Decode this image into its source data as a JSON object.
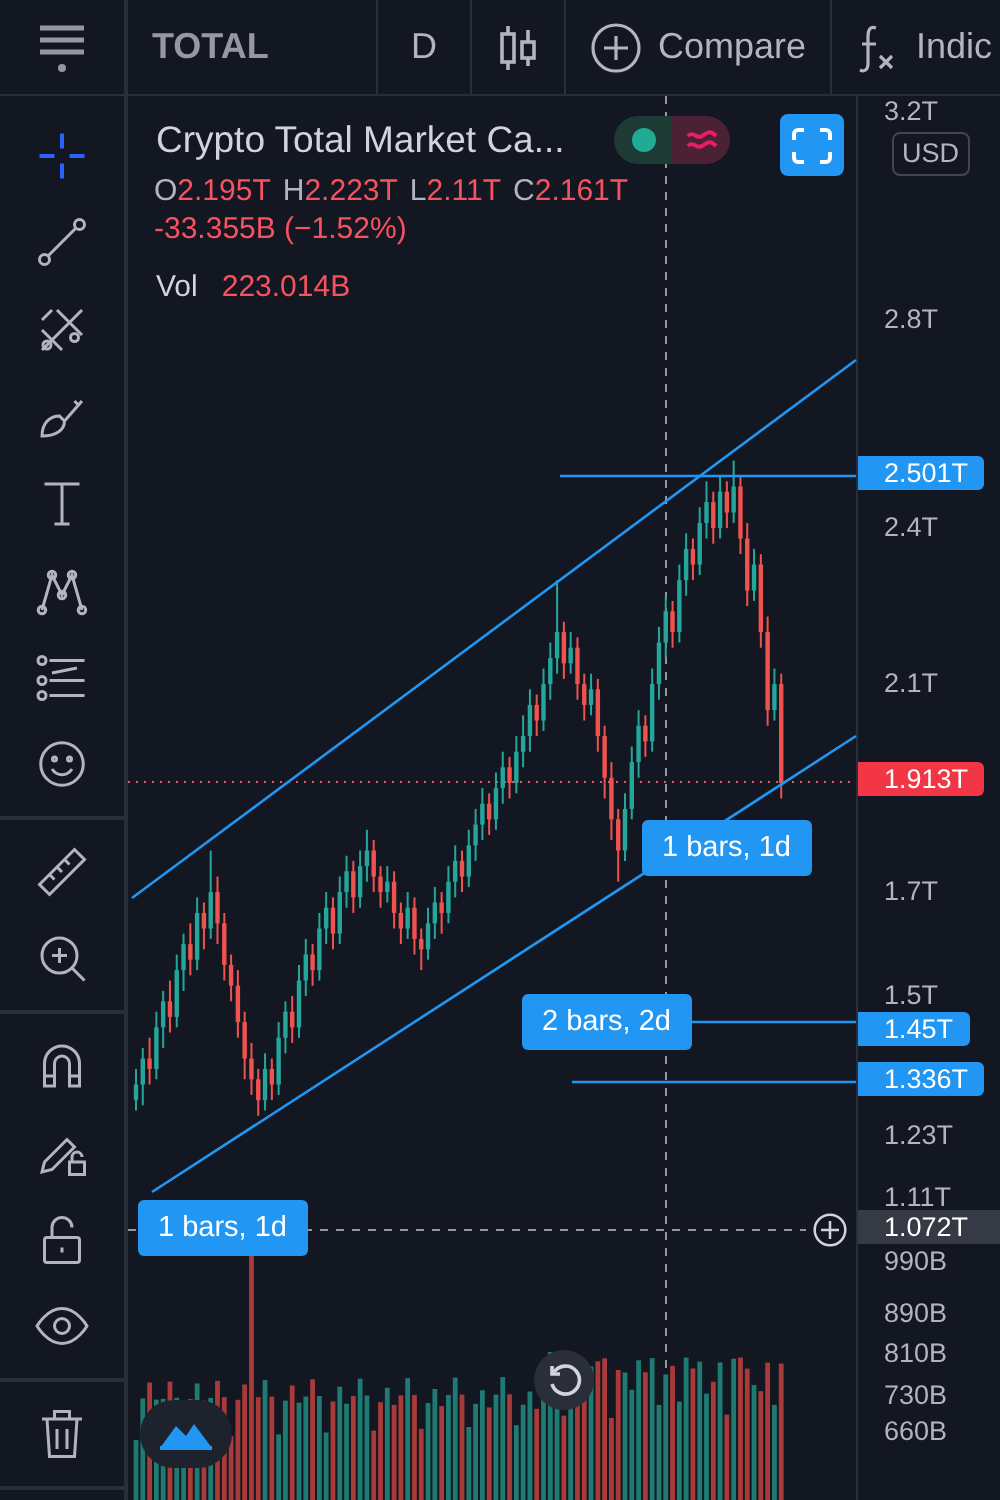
{
  "top_bar": {
    "symbol": "TOTAL",
    "interval": "D",
    "compare": "Compare",
    "indicators": "Indic"
  },
  "tool_groups": [
    [
      {
        "kind": "crosshair",
        "selected": true
      },
      {
        "kind": "line",
        "selected": false
      },
      {
        "kind": "pitchfork",
        "selected": false
      },
      {
        "kind": "brush",
        "selected": false
      },
      {
        "kind": "text",
        "selected": false
      },
      {
        "kind": "pattern",
        "selected": false
      },
      {
        "kind": "forecast",
        "selected": false
      },
      {
        "kind": "emoji",
        "selected": false
      }
    ],
    [
      {
        "kind": "ruler",
        "selected": false
      },
      {
        "kind": "zoom",
        "selected": false
      }
    ],
    [
      {
        "kind": "magnet",
        "selected": false
      },
      {
        "kind": "pencil-lock",
        "selected": false
      },
      {
        "kind": "lock",
        "selected": false
      },
      {
        "kind": "eye",
        "selected": false
      }
    ],
    [
      {
        "kind": "trash",
        "selected": false
      }
    ]
  ],
  "legend": {
    "title": "Crypto Total Market Ca...",
    "ohlc": [
      {
        "label": "O",
        "value": "2.195T"
      },
      {
        "label": "H",
        "value": "2.223T"
      },
      {
        "label": "L",
        "value": "2.11T"
      },
      {
        "label": "C",
        "value": "2.161T"
      }
    ],
    "change": "-33.355B (−1.52%)",
    "volume_label": "Vol",
    "volume_value": "223.014B"
  },
  "currency": "USD",
  "chart_data": {
    "type": "candlestick",
    "ylim": [
      531000000000,
      3231000000000
    ],
    "ohlc": [
      [
        1300000000000,
        1360000000000,
        1280000000000,
        1330000000000
      ],
      [
        1330000000000,
        1400000000000,
        1290000000000,
        1380000000000
      ],
      [
        1380000000000,
        1420000000000,
        1330000000000,
        1360000000000
      ],
      [
        1360000000000,
        1470000000000,
        1340000000000,
        1440000000000
      ],
      [
        1440000000000,
        1510000000000,
        1400000000000,
        1490000000000
      ],
      [
        1490000000000,
        1530000000000,
        1430000000000,
        1460000000000
      ],
      [
        1460000000000,
        1580000000000,
        1440000000000,
        1550000000000
      ],
      [
        1550000000000,
        1620000000000,
        1510000000000,
        1600000000000
      ],
      [
        1600000000000,
        1640000000000,
        1540000000000,
        1570000000000
      ],
      [
        1570000000000,
        1690000000000,
        1550000000000,
        1660000000000
      ],
      [
        1660000000000,
        1680000000000,
        1590000000000,
        1630000000000
      ],
      [
        1630000000000,
        1780000000000,
        1610000000000,
        1700000000000
      ],
      [
        1700000000000,
        1730000000000,
        1600000000000,
        1640000000000
      ],
      [
        1640000000000,
        1660000000000,
        1530000000000,
        1560000000000
      ],
      [
        1560000000000,
        1580000000000,
        1490000000000,
        1520000000000
      ],
      [
        1520000000000,
        1550000000000,
        1420000000000,
        1450000000000
      ],
      [
        1450000000000,
        1470000000000,
        1340000000000,
        1380000000000
      ],
      [
        1380000000000,
        1410000000000,
        1310000000000,
        1340000000000
      ],
      [
        1340000000000,
        1360000000000,
        1270000000000,
        1300000000000
      ],
      [
        1300000000000,
        1390000000000,
        1280000000000,
        1360000000000
      ],
      [
        1360000000000,
        1380000000000,
        1300000000000,
        1330000000000
      ],
      [
        1330000000000,
        1450000000000,
        1310000000000,
        1420000000000
      ],
      [
        1420000000000,
        1490000000000,
        1390000000000,
        1470000000000
      ],
      [
        1470000000000,
        1500000000000,
        1410000000000,
        1440000000000
      ],
      [
        1440000000000,
        1560000000000,
        1420000000000,
        1530000000000
      ],
      [
        1530000000000,
        1610000000000,
        1500000000000,
        1580000000000
      ],
      [
        1580000000000,
        1600000000000,
        1520000000000,
        1550000000000
      ],
      [
        1550000000000,
        1660000000000,
        1530000000000,
        1630000000000
      ],
      [
        1630000000000,
        1700000000000,
        1600000000000,
        1670000000000
      ],
      [
        1670000000000,
        1690000000000,
        1590000000000,
        1620000000000
      ],
      [
        1620000000000,
        1730000000000,
        1600000000000,
        1700000000000
      ],
      [
        1700000000000,
        1770000000000,
        1670000000000,
        1740000000000
      ],
      [
        1740000000000,
        1760000000000,
        1660000000000,
        1690000000000
      ],
      [
        1690000000000,
        1780000000000,
        1670000000000,
        1750000000000
      ],
      [
        1750000000000,
        1820000000000,
        1720000000000,
        1780000000000
      ],
      [
        1780000000000,
        1800000000000,
        1700000000000,
        1730000000000
      ],
      [
        1730000000000,
        1750000000000,
        1670000000000,
        1700000000000
      ],
      [
        1700000000000,
        1750000000000,
        1680000000000,
        1720000000000
      ],
      [
        1720000000000,
        1740000000000,
        1630000000000,
        1660000000000
      ],
      [
        1660000000000,
        1680000000000,
        1600000000000,
        1630000000000
      ],
      [
        1630000000000,
        1700000000000,
        1610000000000,
        1670000000000
      ],
      [
        1670000000000,
        1690000000000,
        1580000000000,
        1610000000000
      ],
      [
        1610000000000,
        1630000000000,
        1550000000000,
        1590000000000
      ],
      [
        1590000000000,
        1670000000000,
        1570000000000,
        1640000000000
      ],
      [
        1640000000000,
        1710000000000,
        1610000000000,
        1680000000000
      ],
      [
        1680000000000,
        1700000000000,
        1620000000000,
        1660000000000
      ],
      [
        1660000000000,
        1750000000000,
        1640000000000,
        1720000000000
      ],
      [
        1720000000000,
        1790000000000,
        1690000000000,
        1760000000000
      ],
      [
        1760000000000,
        1780000000000,
        1700000000000,
        1730000000000
      ],
      [
        1730000000000,
        1820000000000,
        1710000000000,
        1790000000000
      ],
      [
        1790000000000,
        1860000000000,
        1760000000000,
        1830000000000
      ],
      [
        1830000000000,
        1900000000000,
        1800000000000,
        1870000000000
      ],
      [
        1870000000000,
        1890000000000,
        1810000000000,
        1840000000000
      ],
      [
        1840000000000,
        1930000000000,
        1820000000000,
        1900000000000
      ],
      [
        1900000000000,
        1970000000000,
        1870000000000,
        1940000000000
      ],
      [
        1940000000000,
        1960000000000,
        1880000000000,
        1910000000000
      ],
      [
        1910000000000,
        2000000000000,
        1890000000000,
        1970000000000
      ],
      [
        1970000000000,
        2040000000000,
        1940000000000,
        2000000000000
      ],
      [
        2000000000000,
        2090000000000,
        1970000000000,
        2060000000000
      ],
      [
        2060000000000,
        2080000000000,
        2000000000000,
        2030000000000
      ],
      [
        2030000000000,
        2130000000000,
        2010000000000,
        2100000000000
      ],
      [
        2100000000000,
        2180000000000,
        2070000000000,
        2150000000000
      ],
      [
        2150000000000,
        2300000000000,
        2120000000000,
        2200000000000
      ],
      [
        2200000000000,
        2220000000000,
        2110000000000,
        2140000000000
      ],
      [
        2140000000000,
        2200000000000,
        2120000000000,
        2170000000000
      ],
      [
        2170000000000,
        2190000000000,
        2070000000000,
        2100000000000
      ],
      [
        2100000000000,
        2120000000000,
        2030000000000,
        2060000000000
      ],
      [
        2060000000000,
        2120000000000,
        2040000000000,
        2090000000000
      ],
      [
        2090000000000,
        2110000000000,
        1970000000000,
        2000000000000
      ],
      [
        2000000000000,
        2020000000000,
        1880000000000,
        1920000000000
      ],
      [
        1920000000000,
        1950000000000,
        1800000000000,
        1840000000000
      ],
      [
        1840000000000,
        1860000000000,
        1720000000000,
        1780000000000
      ],
      [
        1780000000000,
        1890000000000,
        1760000000000,
        1860000000000
      ],
      [
        1860000000000,
        1980000000000,
        1840000000000,
        1950000000000
      ],
      [
        1950000000000,
        2050000000000,
        1920000000000,
        2020000000000
      ],
      [
        2020000000000,
        2040000000000,
        1960000000000,
        1990000000000
      ],
      [
        1990000000000,
        2130000000000,
        1970000000000,
        2100000000000
      ],
      [
        2100000000000,
        2210000000000,
        2070000000000,
        2180000000000
      ],
      [
        2180000000000,
        2270000000000,
        2150000000000,
        2240000000000
      ],
      [
        2240000000000,
        2260000000000,
        2170000000000,
        2200000000000
      ],
      [
        2200000000000,
        2330000000000,
        2180000000000,
        2300000000000
      ],
      [
        2300000000000,
        2390000000000,
        2270000000000,
        2360000000000
      ],
      [
        2360000000000,
        2380000000000,
        2300000000000,
        2330000000000
      ],
      [
        2330000000000,
        2440000000000,
        2310000000000,
        2410000000000
      ],
      [
        2410000000000,
        2490000000000,
        2380000000000,
        2450000000000
      ],
      [
        2450000000000,
        2470000000000,
        2370000000000,
        2400000000000
      ],
      [
        2400000000000,
        2500000000000,
        2380000000000,
        2470000000000
      ],
      [
        2470000000000,
        2490000000000,
        2400000000000,
        2430000000000
      ],
      [
        2430000000000,
        2530000000000,
        2410000000000,
        2480000000000
      ],
      [
        2480000000000,
        2500000000000,
        2350000000000,
        2380000000000
      ],
      [
        2380000000000,
        2410000000000,
        2250000000000,
        2280000000000
      ],
      [
        2280000000000,
        2360000000000,
        2260000000000,
        2330000000000
      ],
      [
        2330000000000,
        2350000000000,
        2170000000000,
        2200000000000
      ],
      [
        2200000000000,
        2230000000000,
        2020000000000,
        2050000000000
      ],
      [
        2050000000000,
        2130000000000,
        2030000000000,
        2100000000000
      ],
      [
        2100000000000,
        2120000000000,
        1880000000000,
        1910000000000
      ]
    ],
    "yticks": [
      {
        "value": 3200000000000,
        "label": "3.2T"
      },
      {
        "value": 2800000000000,
        "label": "2.8T"
      },
      {
        "value": 2400000000000,
        "label": "2.4T"
      },
      {
        "value": 2100000000000,
        "label": "2.1T"
      },
      {
        "value": 1700000000000,
        "label": "1.7T"
      },
      {
        "value": 1500000000000,
        "label": "1.5T"
      },
      {
        "value": 1230000000000,
        "label": "1.23T"
      },
      {
        "value": 1110000000000,
        "label": "1.11T"
      },
      {
        "value": 990000000000,
        "label": "990B"
      },
      {
        "value": 890000000000,
        "label": "890B"
      },
      {
        "value": 810000000000,
        "label": "810B"
      },
      {
        "value": 730000000000,
        "label": "730B"
      },
      {
        "value": 660000000000,
        "label": "660B"
      }
    ]
  },
  "price_labels": [
    {
      "text": "2.501T",
      "kind": "line"
    },
    {
      "text": "1.913T",
      "kind": "last"
    },
    {
      "text": "1.45T",
      "kind": "line"
    },
    {
      "text": "1.336T",
      "kind": "line"
    },
    {
      "text": "1.072T",
      "kind": "cursor"
    }
  ],
  "measure_labels": [
    "1 bars, 1d",
    "2 bars, 2d",
    "1 bars, 1d"
  ]
}
